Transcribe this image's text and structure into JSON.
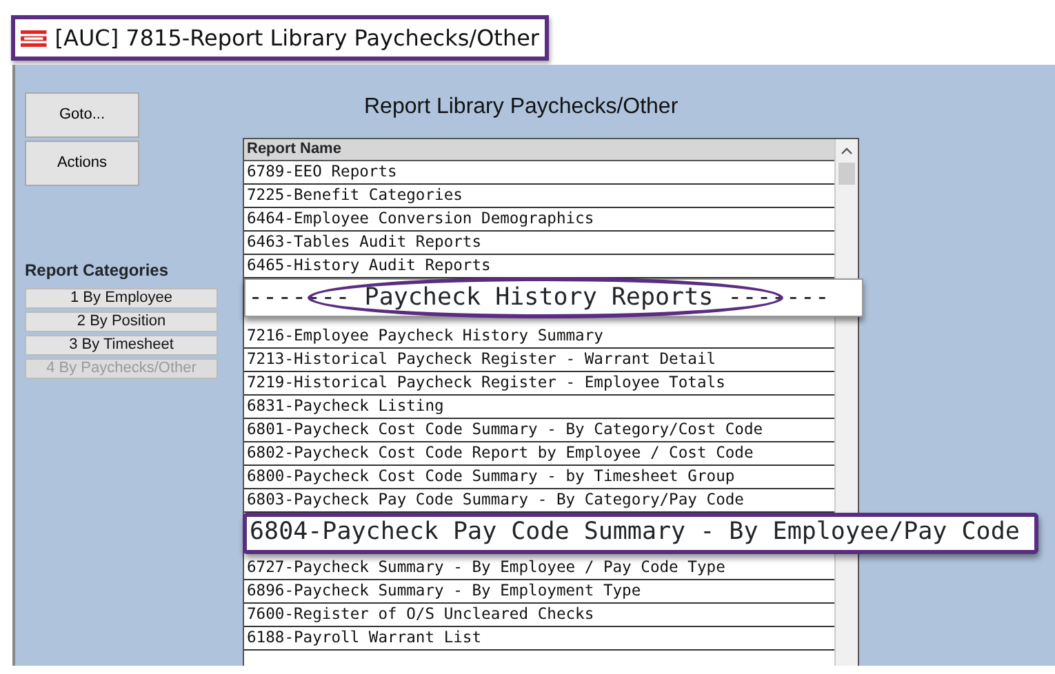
{
  "window": {
    "title": "[AUC] 7815-Report Library Paychecks/Other",
    "highlighted": true
  },
  "sidebar": {
    "buttons": [
      "Goto...",
      "Actions"
    ],
    "categories_title": "Report Categories",
    "categories": [
      {
        "label": "1 By Employee",
        "disabled": false
      },
      {
        "label": "2 By Position",
        "disabled": false
      },
      {
        "label": "3 By Timesheet",
        "disabled": false
      },
      {
        "label": "4 By Paychecks/Other",
        "disabled": true
      }
    ]
  },
  "heading": "Report Library Paychecks/Other",
  "list": {
    "column": "Report Name",
    "rows": [
      {
        "kind": "row",
        "text": "6789-EEO Reports"
      },
      {
        "kind": "row",
        "text": "7225-Benefit Categories"
      },
      {
        "kind": "row",
        "text": "6464-Employee Conversion Demographics"
      },
      {
        "kind": "row",
        "text": "6463-Tables Audit Reports"
      },
      {
        "kind": "row",
        "text": "6465-History Audit Reports"
      },
      {
        "kind": "section",
        "text": "------- Paycheck History Reports -------",
        "circled": true
      },
      {
        "kind": "row",
        "text": "7216-Employee Paycheck History Summary"
      },
      {
        "kind": "row",
        "text": "7213-Historical Paycheck Register - Warrant Detail"
      },
      {
        "kind": "row",
        "text": "7219-Historical Paycheck Register - Employee Totals"
      },
      {
        "kind": "row",
        "text": "6831-Paycheck Listing"
      },
      {
        "kind": "row",
        "text": "6801-Paycheck Cost Code Summary - By Category/Cost Code"
      },
      {
        "kind": "row",
        "text": "6802-Paycheck Cost Code Report by Employee / Cost Code"
      },
      {
        "kind": "row",
        "text": "6800-Paycheck Cost Code Summary - by Timesheet Group"
      },
      {
        "kind": "row",
        "text": "6803-Paycheck Pay Code Summary - By Category/Pay Code"
      },
      {
        "kind": "callout",
        "text": "6804-Paycheck Pay Code Summary - By Employee/Pay Code"
      },
      {
        "kind": "row",
        "text": "6727-Paycheck Summary - By Employee / Pay Code Type"
      },
      {
        "kind": "row",
        "text": "6896-Paycheck Summary - By Employment Type"
      },
      {
        "kind": "row",
        "text": "7600-Register of O/S Uncleared Checks"
      },
      {
        "kind": "row",
        "text": "6188-Payroll Warrant List"
      }
    ]
  }
}
